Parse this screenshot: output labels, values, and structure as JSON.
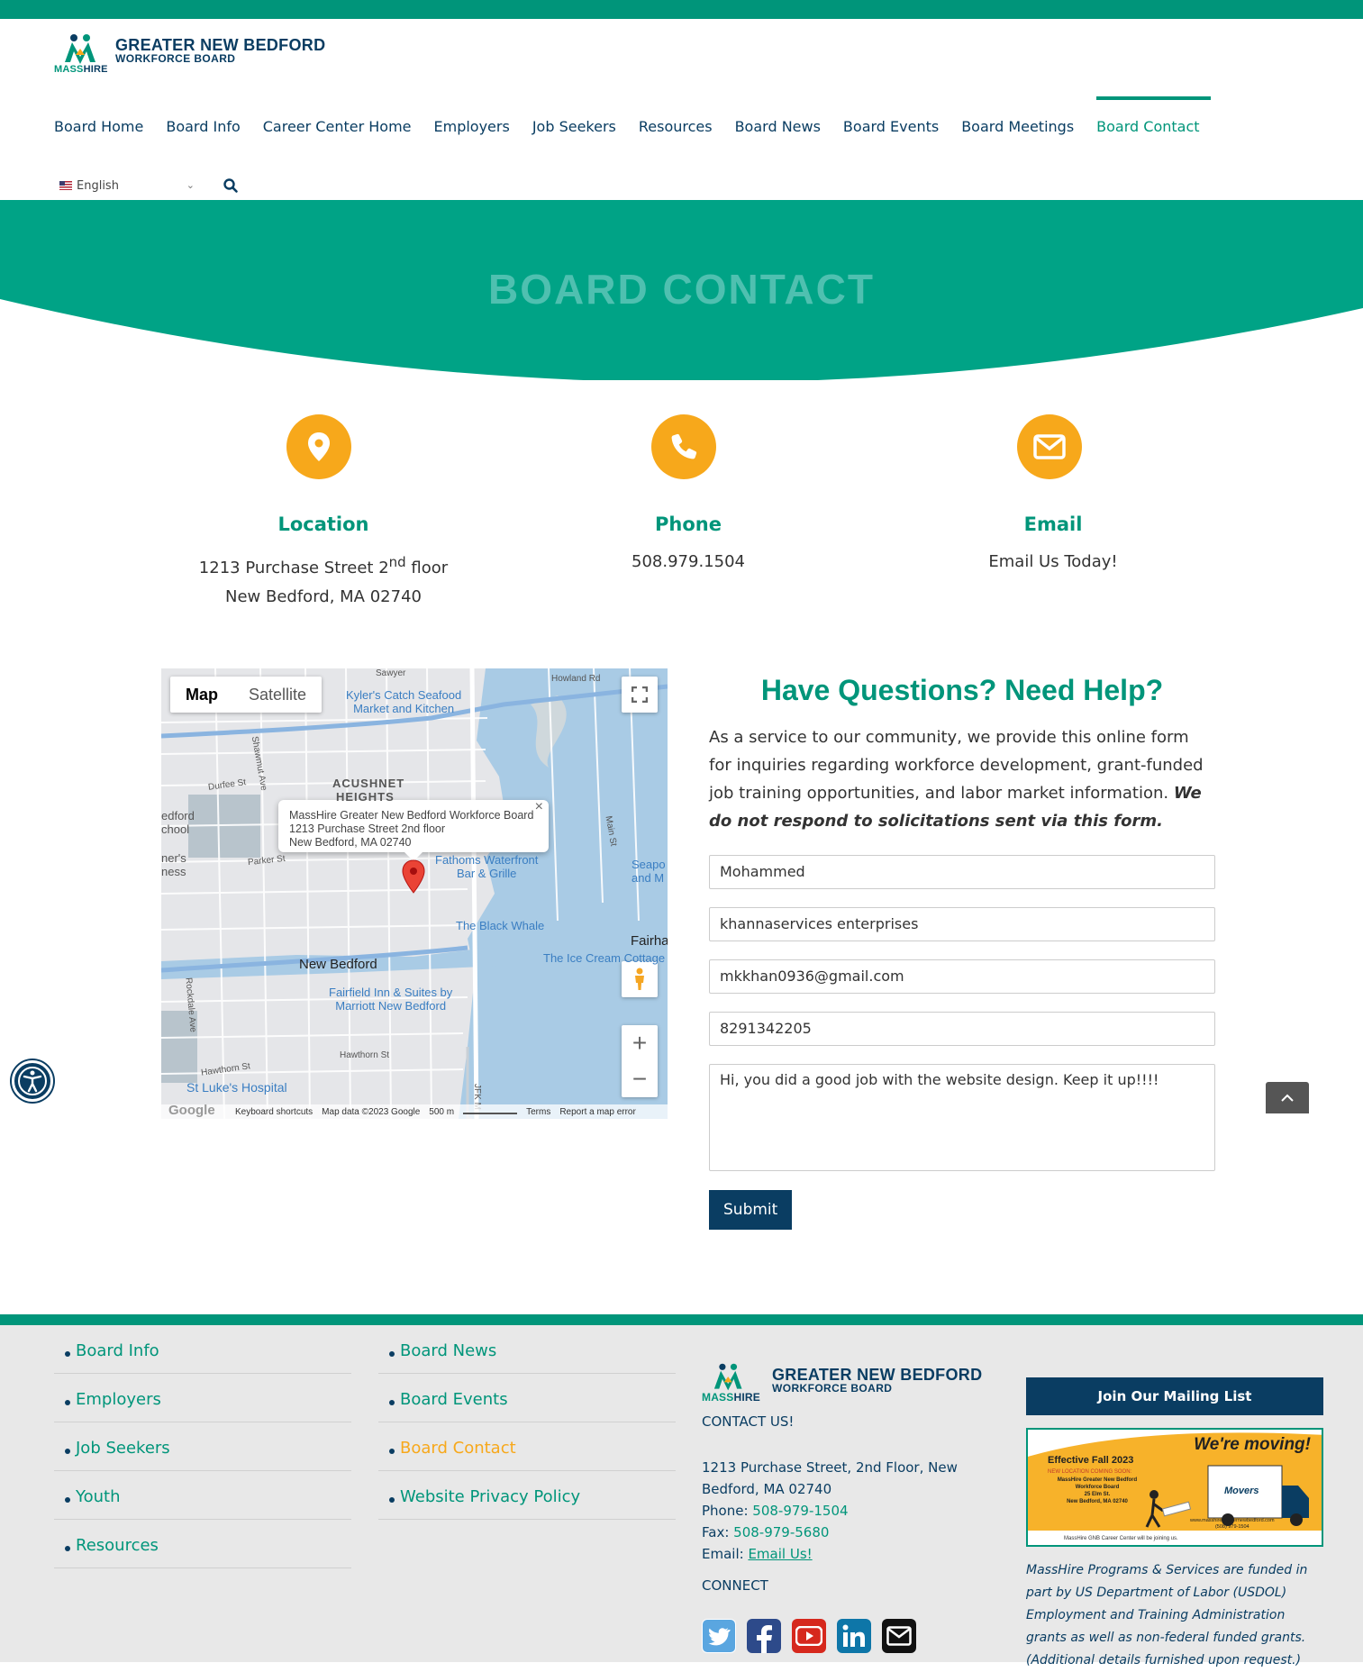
{
  "colors": {
    "accent": "#00957a",
    "navy": "#0a3d62",
    "orange": "#f7a81b"
  },
  "logo": {
    "line1": "GREATER NEW BEDFORD",
    "line2": "WORKFORCE BOARD",
    "mass": "MASS",
    "hire": "HIRE"
  },
  "nav": [
    "Board Home",
    "Board Info",
    "Career Center Home",
    "Employers",
    "Job Seekers",
    "Resources",
    "Board News",
    "Board Events",
    "Board Meetings",
    "Board Contact"
  ],
  "language": {
    "selected": "English"
  },
  "hero": {
    "title": "BOARD CONTACT"
  },
  "contact": {
    "location": {
      "title": "Location",
      "line1_pre": "1213 Purchase Street 2",
      "line1_sup": "nd",
      "line1_post": " floor",
      "line2": "New Bedford, MA 02740",
      "icon": "map-pin-icon"
    },
    "phone": {
      "title": "Phone",
      "value": "508.979.1504",
      "icon": "phone-icon"
    },
    "email": {
      "title": "Email",
      "value": "Email Us Today!",
      "icon": "envelope-icon"
    }
  },
  "map": {
    "map_label": "Map",
    "satellite_label": "Satellite",
    "info_title": "MassHire Greater New Bedford Workforce Board",
    "info_line2": "1213 Purchase Street 2nd floor",
    "info_line3": "New Bedford, MA 02740",
    "labels": {
      "acushnet1": "ACUSHNET",
      "acushnet2": "HEIGHTS",
      "new_bedford": "New Bedford",
      "kylers1": "Kyler's Catch Seafood",
      "kylers2": "Market and Kitchen",
      "fathoms1": "Fathoms Waterfront",
      "fathoms2": "Bar & Grille",
      "black_whale": "The Black Whale",
      "ice_cream": "The Ice Cream Cottage",
      "fairfield1": "Fairfield Inn & Suites by",
      "fairfield2": "Marriott New Bedford",
      "st_lukes": "St Luke's Hospital",
      "durfee": "Durfee St",
      "parker": "Parker St",
      "hawthorn1": "Hawthorn St",
      "hawthorn2": "Hawthorn St",
      "howland": "Howland Rd",
      "sawyer": "Sawyer",
      "shawmut": "Shawmut Ave",
      "main": "Main St",
      "rockdale": "Rockdale Ave",
      "jfk": "JFK M",
      "fairha": "Fairha",
      "seapo1": "Seapo",
      "seapo2": "and M",
      "edford": "edford",
      "school": "chool",
      "ners": "ner's",
      "ness": "ness"
    },
    "footer": {
      "google": "Google",
      "shortcuts": "Keyboard shortcuts",
      "data": "Map data ©2023 Google",
      "scale": "500 m",
      "terms": "Terms",
      "report": "Report a map error"
    }
  },
  "form": {
    "heading": "Have Questions? Need Help?",
    "intro": "As a service to our community, we provide this online form for inquiries regarding workforce development, grant-funded job training opportunities, and labor market information. ",
    "intro_em": "We do not respond to solicitations sent via this form.",
    "name": "Mohammed",
    "company": "khannaservices enterprises",
    "email": "mkkhan0936@gmail.com",
    "phone": "8291342205",
    "message": "Hi, you did a good job with the website design. Keep it up!!!!",
    "submit": "Submit"
  },
  "footer": {
    "col1": [
      "Board Info",
      "Employers",
      "Job Seekers",
      "Youth",
      "Resources"
    ],
    "col2": [
      "Board News",
      "Board Events",
      "Board Contact",
      "Website Privacy Policy"
    ],
    "contact_us": "CONTACT US!",
    "address1": "1213 Purchase Street, 2nd Floor, New",
    "address2": "Bedford, MA 02740",
    "phone_label": "Phone: ",
    "phone": "508-979-1504",
    "fax_label": "Fax: ",
    "fax": "508-979-5680",
    "email_label": "Email: ",
    "email": "Email Us!",
    "connect": "CONNECT",
    "social": [
      "twitter-icon",
      "facebook-icon",
      "youtube-icon",
      "linkedin-icon",
      "email-icon"
    ],
    "mailing": "Join Our Mailing List",
    "moving": {
      "headline": "We're moving!",
      "effective": "Effective Fall 2023",
      "new_loc": "NEW LOCATION COMING SOON:",
      "org1": "MassHire Greater New Bedford",
      "org2": "Workforce Board",
      "street": "25 Elm St.",
      "city": "New Bedford, MA 02740",
      "movers": "Movers",
      "site": "www.masshiregreaternewbedford.com",
      "phone": "(508) 979-1504",
      "bottom": "MassHire GNB Career Center will be joining us."
    },
    "note": "MassHire Programs & Services are funded in part by US Department of Labor (USDOL) Employment and Training Administration grants as well as non-federal funded grants. (Additional details furnished upon request.)"
  }
}
